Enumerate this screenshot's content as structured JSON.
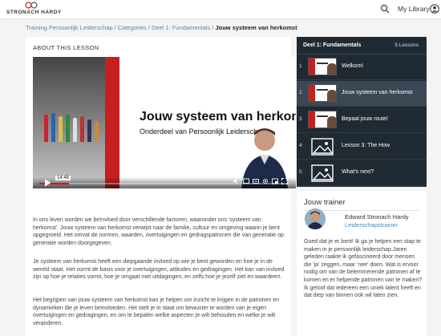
{
  "header": {
    "logo_text": "STRONACH HARDY",
    "my_library": "My Library"
  },
  "breadcrumb": {
    "items": [
      "Training Persoonlijk Leiderschap",
      "Categories",
      "Deel 1: Fundamentals"
    ],
    "current": "Jouw systeem van herkomst"
  },
  "lesson": {
    "section_label": "ABOUT THIS LESSON",
    "video": {
      "title": "Jouw systeem van herkomst",
      "subtitle": "Onderdeel van Persoonlijk Leiderschap",
      "timestamp": "14:48",
      "progress": 0.12
    },
    "paragraphs": [
      "In ons leven worden we beïnvloed door verschillende factoren, waaronder ons 'systeem van herkomst'. Jouw systeem van herkomst verwijst naar de familie, cultuur en omgeving waarin je bent opgegroeid. Het omvat de normen, waarden, overtuigingen en gedragspatronen die van generatie op generatie worden doorgegeven.",
      "Je systeem van herkomst heeft een diepgaande invloed op wie je bent geworden en hoe je in de wereld staat. Het vormt de basis voor je overtuigingen, attitudes en gedragingen. Het kan van invloed zijn op hoe je relaties vormt, hoe je omgaat met uitdagingen, en zelfs hoe je jezelf ziet en waardeert.",
      "Het begrijpen van jouw systeem van herkomst kan je helpen om inzicht te krijgen in de patronen en dynamieken die je leven beïnvloeden. Het stelt je in staat om bewuster te worden van je eigen overtuigingen en gedragingen, en om te bepalen welke aspecten je wilt behouden en welke je wilt veranderen."
    ]
  },
  "lessons_panel": {
    "title": "Deel 1: Fundamentals",
    "count": "5 Lessons",
    "items": [
      {
        "num": "1",
        "title": "Welkom!",
        "thumb": "video",
        "active": false
      },
      {
        "num": "2",
        "title": "Jouw systeem van herkomst",
        "thumb": "video",
        "active": true
      },
      {
        "num": "3",
        "title": "Bepaal jouw route!",
        "thumb": "video",
        "active": false
      },
      {
        "num": "4",
        "title": "Lesson 3: The How",
        "thumb": "image-icon",
        "active": false
      },
      {
        "num": "5",
        "title": "What's next?",
        "thumb": "image-icon",
        "active": false
      }
    ]
  },
  "trainer": {
    "heading": "Jouw trainer",
    "name": "Edward Stronach Hardy",
    "role": "Leiderschapstrainer",
    "bio": "Goed dat je er bent! Ik ga je helpen een stap te maken in je persoonlijk leiderschap.Jaren geleden raakte ik gefascineerd door mensen die 'ja' zeggen, maar 'nee' doen. Wat is ervoor nodig om van de belemmerende patronen af te komen en er helpende patronen van te maken? Ik geloof dat iedereen een uniek talent heeft en dat diep van binnen ook wil laten zien."
  },
  "colors": {
    "accent_link": "#4a8ac4",
    "panel_dark": "#1f2a33",
    "panel_active": "#3a4755",
    "video_red": "#c42020"
  }
}
